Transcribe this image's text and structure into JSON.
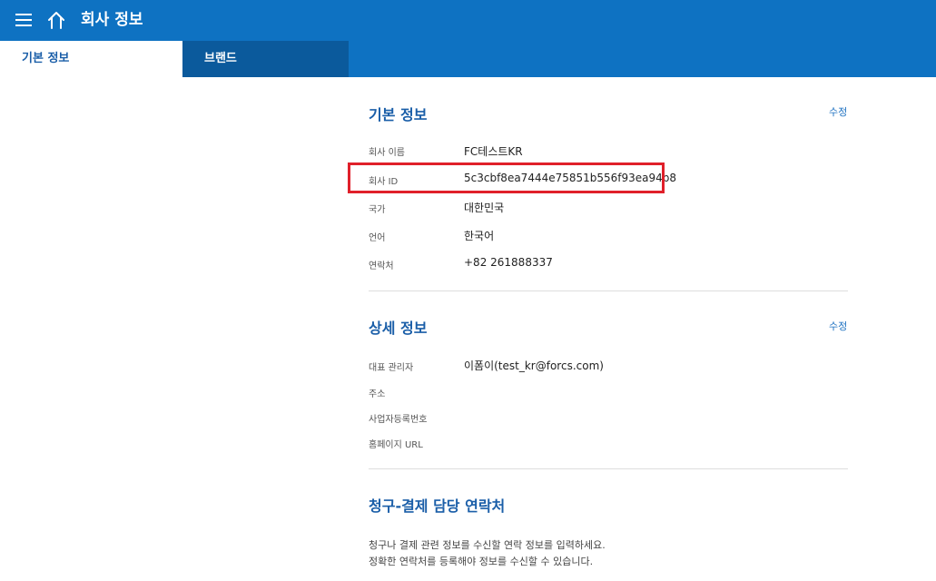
{
  "header": {
    "title": "회사 정보",
    "icons": {
      "menu": "hamburger-menu-icon",
      "home": "home-icon"
    }
  },
  "tabs": [
    {
      "label": "기본 정보",
      "active": true
    },
    {
      "label": "브랜드",
      "active": false
    }
  ],
  "basic_info": {
    "title": "기본 정보",
    "edit_label": "수정",
    "rows": [
      {
        "label": "회사 이름",
        "value": "FC테스트KR"
      },
      {
        "label": "회사 ID",
        "value": "5c3cbf8ea7444e75851b556f93ea94b8"
      },
      {
        "label": "국가",
        "value": "대한민국"
      },
      {
        "label": "언어",
        "value": "한국어"
      },
      {
        "label": "연락처",
        "value": "+82 261888337"
      }
    ]
  },
  "detail_info": {
    "title": "상세 정보",
    "edit_label": "수정",
    "rows": [
      {
        "label": "대표 관리자",
        "value": "이폼이(test_kr@forcs.com)"
      },
      {
        "label": "주소",
        "value": ""
      },
      {
        "label": "사업자등록번호",
        "value": ""
      },
      {
        "label": "홈페이지 URL",
        "value": ""
      }
    ]
  },
  "billing_contact": {
    "title": "청구-결제 담당 연락처",
    "desc_lines": [
      "청구나 결제 관련 정보를 수신할 연락 정보를 입력하세요.",
      "정확한 연락처를 등록해야 정보를 수신할 수 있습니다."
    ]
  },
  "colors": {
    "header_bg": "#0e72c2",
    "inactive_tab_bg": "#0b5a9c",
    "section_title": "#1a5ea8",
    "highlight_border": "#e0202a"
  }
}
